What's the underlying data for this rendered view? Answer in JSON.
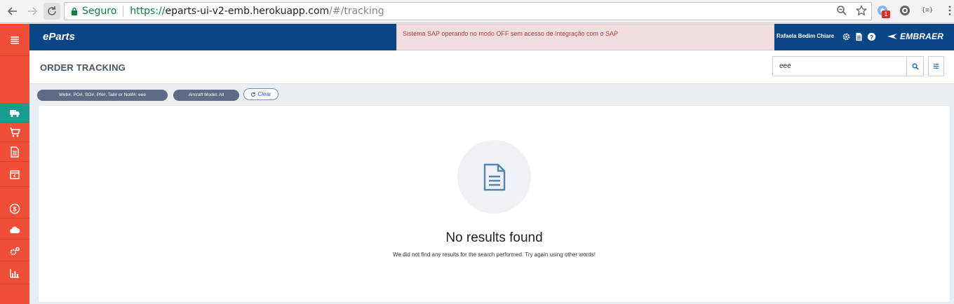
{
  "browser": {
    "secure_label": "Seguro",
    "url_scheme": "https://",
    "url_host": "eparts-ui-v2-emb.herokuapp.com",
    "url_path": "/#/tracking",
    "extension_badge": "1",
    "json_ext_label": "{≡}"
  },
  "header": {
    "brand": "eParts",
    "sap_alert": "Sistema SAP operando no modo OFF sem acesso de Integração com o SAP",
    "user_name": "Rafaela Bedim Chiare",
    "company_logo": "EMBRAER"
  },
  "sidebar": {
    "items": [
      {
        "icon": "menu-icon"
      },
      {
        "icon": "truck-icon",
        "active": true
      },
      {
        "icon": "cart-icon"
      },
      {
        "icon": "document-icon"
      },
      {
        "icon": "package-return-icon"
      },
      {
        "icon": "dollar-icon"
      },
      {
        "icon": "cloud-icon"
      },
      {
        "icon": "gears-icon"
      },
      {
        "icon": "bar-chart-icon"
      }
    ]
  },
  "page": {
    "title": "ORDER TRACKING",
    "search_value": "eee"
  },
  "filters": {
    "chips": [
      "Web#, PO#, SO#, PN#, Tail# or Notif#: eee",
      "Aircraft Model: All"
    ],
    "clear_label": "Clear"
  },
  "empty_state": {
    "title": "No results found",
    "message": "We did not find any results for the search performed. Try again using other words!"
  },
  "colors": {
    "sidebar": "#f04e37",
    "sidebar_active": "#1a9b8f",
    "appbar": "#0a4685",
    "alert_bg": "#f2dedf",
    "alert_text": "#b0443d"
  }
}
